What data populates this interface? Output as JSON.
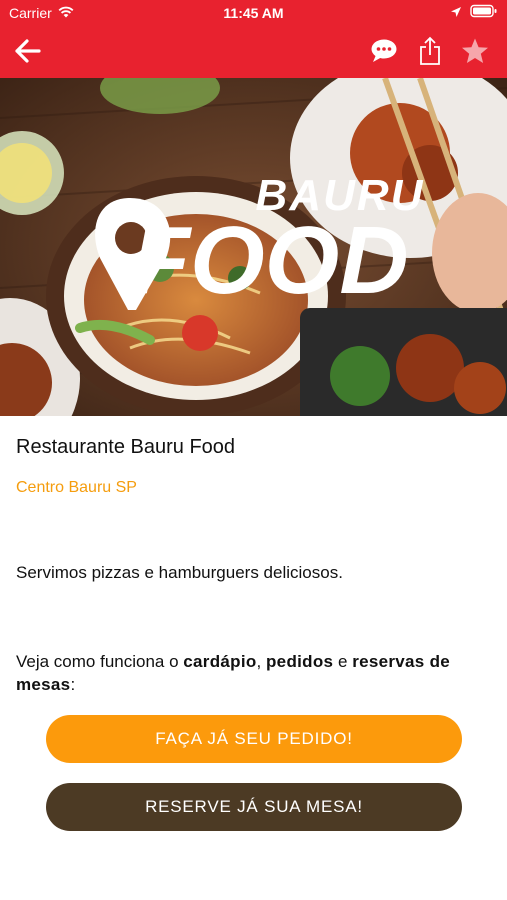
{
  "status_bar": {
    "carrier": "Carrier",
    "time": "11:45 AM"
  },
  "nav": {
    "back_icon": "arrow-left-icon",
    "chat_icon": "chat-bubble-icon",
    "share_icon": "share-icon",
    "favorite_icon": "star-icon",
    "background_color": "#e8222f"
  },
  "hero": {
    "logo_top": "BAURU",
    "logo_bottom": "FOOD"
  },
  "restaurant": {
    "name": "Restaurante Bauru Food",
    "location": "Centro Bauru SP",
    "description": "Servimos pizzas e hamburguers deliciosos."
  },
  "howto": {
    "prefix": "Veja como funciona o ",
    "menu": "cardápio",
    "sep1": ", ",
    "orders": "pedidos",
    "sep2": " e ",
    "reservations": "reservas de mesas",
    "suffix": ":"
  },
  "buttons": {
    "order_label": "FAÇA JÁ SEU PEDIDO!",
    "reserve_label": "RESERVE JÁ SUA MESA!"
  },
  "colors": {
    "accent": "#fc9a0c",
    "location_text": "#f59d0e",
    "reserve_button": "#4c3a24"
  }
}
